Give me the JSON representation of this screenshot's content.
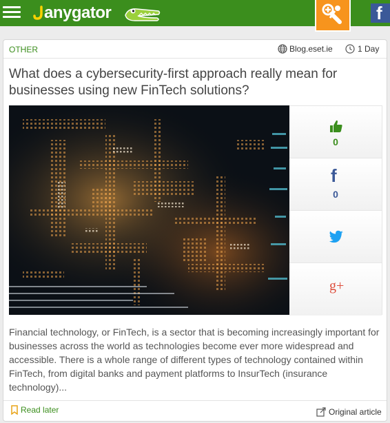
{
  "header": {
    "logo_text": "anygator",
    "menu_icon": "hamburger-icon",
    "add_icon": "add-source-icon",
    "facebook_icon": "facebook-icon",
    "facebook_glyph": "f",
    "colors": {
      "bar": "#3b8e1d",
      "add": "#f7941d",
      "facebook": "#3b5998"
    }
  },
  "article": {
    "category": "OTHER",
    "source": "Blog.eset.ie",
    "age": "1 Day",
    "title": "What does a cybersecurity-first approach really mean for businesses using new FinTech solutions?",
    "excerpt": "Financial technology, or FinTech, is a sector that is becoming increasingly important for businesses across the world as technologies become ever more widespread and accessible. There is a whole range of different types of technology contained within FinTech, from digital banks and payment platforms to InsurTech (insurance technology)...",
    "actions": {
      "like_count": "0",
      "facebook_count": "0",
      "facebook_glyph": "f",
      "google_glyph": "g+"
    },
    "footer": {
      "read_later": "Read later",
      "original": "Original article"
    },
    "colors": {
      "accent": "#3b8e1d",
      "facebook": "#3b5998",
      "twitter": "#1da1f2",
      "google": "#dd4b39"
    }
  }
}
